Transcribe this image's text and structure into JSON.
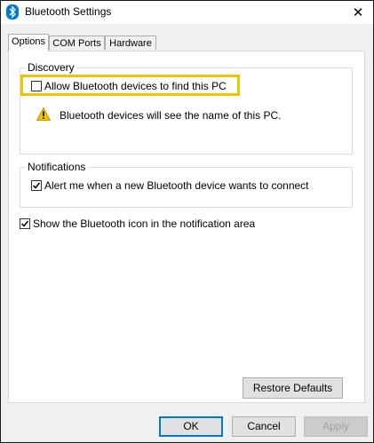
{
  "window": {
    "title": "Bluetooth Settings",
    "close_glyph": "✕",
    "title_icon": "bluetooth-icon"
  },
  "tabs": [
    {
      "label": "Options",
      "active": true
    },
    {
      "label": "COM Ports",
      "active": false
    },
    {
      "label": "Hardware",
      "active": false
    }
  ],
  "discovery": {
    "group_label": "Discovery",
    "allow_label": "Allow Bluetooth devices to find this PC",
    "allow_checked": false,
    "warning_text": "Bluetooth devices will see the name of this PC.",
    "warning_icon": "warning-icon"
  },
  "notifications": {
    "group_label": "Notifications",
    "alert_label": "Alert me when a new Bluetooth device wants to connect",
    "alert_checked": true
  },
  "show_icon": {
    "label": "Show the Bluetooth icon in the notification area",
    "checked": true
  },
  "buttons": {
    "restore": "Restore Defaults",
    "ok": "OK",
    "cancel": "Cancel",
    "apply": "Apply"
  },
  "colors": {
    "highlight": "#f2c300",
    "bluetooth": "#0078d7",
    "warning": "#f2c300"
  }
}
